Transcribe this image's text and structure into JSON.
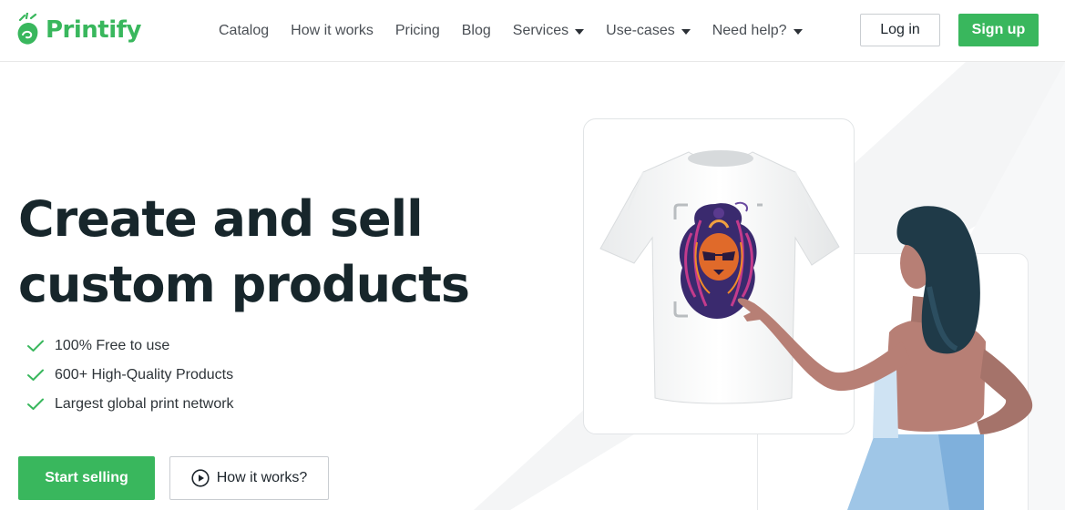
{
  "brand": {
    "name": "Printify",
    "color": "#39b75d"
  },
  "nav": {
    "items": [
      {
        "label": "Catalog",
        "dropdown": false
      },
      {
        "label": "How it works",
        "dropdown": false
      },
      {
        "label": "Pricing",
        "dropdown": false
      },
      {
        "label": "Blog",
        "dropdown": false
      },
      {
        "label": "Services",
        "dropdown": true
      },
      {
        "label": "Use-cases",
        "dropdown": true
      },
      {
        "label": "Need help?",
        "dropdown": true
      }
    ],
    "login_label": "Log in",
    "signup_label": "Sign up"
  },
  "hero": {
    "title_line1": "Create and sell",
    "title_line2": "custom products",
    "features": [
      "100% Free to use",
      "600+ High-Quality Products",
      "Largest global print network"
    ],
    "start_label": "Start selling",
    "how_label": "How it works?"
  },
  "icons": {
    "check": "check-icon",
    "play": "play-circle-icon",
    "caret": "chevron-down-icon"
  },
  "colors": {
    "accent": "#39b75d",
    "title": "#17262b",
    "text": "#4a4f55"
  }
}
